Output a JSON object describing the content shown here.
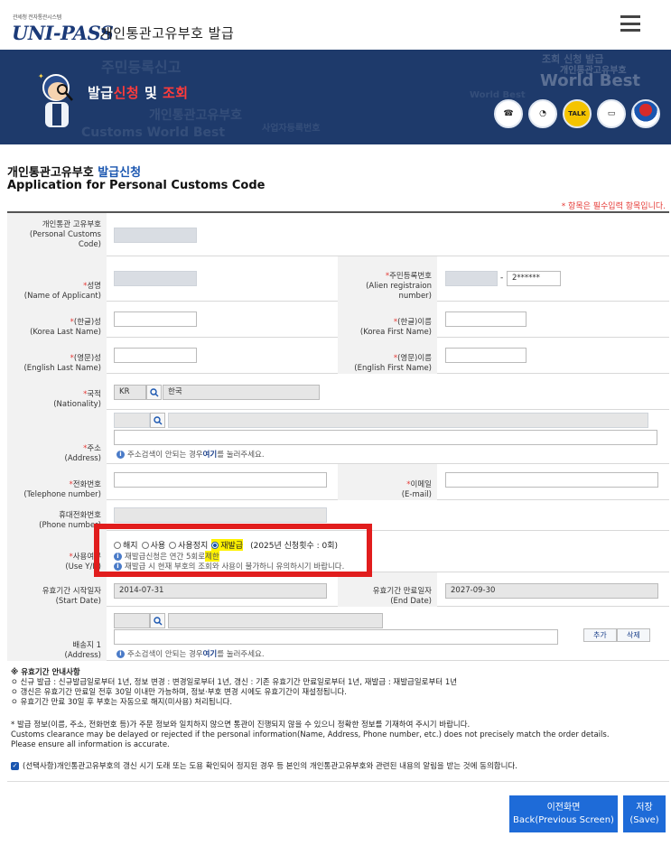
{
  "header": {
    "logo_small": "관세청 전자통관시스템",
    "logo": "UNI-PASS",
    "title": "개인통관고유부호  발급"
  },
  "banner": {
    "title_prefix": "발급",
    "title_red1": "신청",
    "title_mid": " 및 ",
    "title_red2": "조회",
    "bg_texts": [
      "주민등록신고",
      "개인통관고유부호",
      "사업자등록번호",
      "World Best",
      "Customs World Best",
      "조회 신청 발급",
      "World Best",
      "개인통관고유부호"
    ],
    "quick_icons": [
      "phone-icon",
      "clock-icon",
      "talk-icon",
      "monitor-icon",
      "taegeuk-icon"
    ],
    "talk_label": "TALK"
  },
  "page": {
    "title_ko_black": "개인통관고유부호 ",
    "title_ko_blue": "발급신청",
    "title_en": "Application for Personal Customs Code",
    "required_note": "* 항목은 필수입력 항목입니다."
  },
  "form": {
    "pcc_label": "개인통관 고유부호\n(Personal Customs Code)",
    "name_label_ko": "성명",
    "name_label_en": "(Name of Applicant)",
    "alien_label_ko": "주민등록번호",
    "alien_label_en": "(Alien registraion number)",
    "alien_suffix": "2******",
    "alien_dash": "-",
    "last_ko_label_ko": "(한글)성",
    "last_ko_label_en": "(Korea Last Name)",
    "first_ko_label_ko": "(한글)이름",
    "first_ko_label_en": "(Korea First Name)",
    "last_en_label_ko": "(영문)성",
    "last_en_label_en": "(English Last Name)",
    "first_en_label_ko": "(영문)이름",
    "first_en_label_en": "(English First Name)",
    "nation_label_ko": "국적",
    "nation_label_en": "(Nationality)",
    "nation_code": "KR",
    "nation_name": "한국",
    "address_label_ko": "주소",
    "address_label_en": "(Address)",
    "address_info_pre": "주소검색이 안되는 경우 ",
    "address_info_link": "여기",
    "address_info_post": "를 눌러주세요.",
    "tel_label_ko": "전화번호",
    "tel_label_en": "(Telephone number)",
    "email_label_ko": "이메일",
    "email_label_en": "(E-mail)",
    "phone_label_ko": "휴대전화번호",
    "phone_label_en": "(Phone number)",
    "use_label_ko": "사용여부",
    "use_label_en": "(Use Y/N)",
    "use_options": [
      "해지",
      "사용",
      "사용정지",
      "재발급"
    ],
    "reissue_count": "(2025년 신청횟수 : 0회)",
    "use_info1_pre": "재발급신청은 연간 5회로 ",
    "use_info1_hl": "제한",
    "use_info2": "재발급 시 현재 부호의 조회와 사용이 불가하니 유의하시기 바랍니다.",
    "start_label_ko": "유효기간 시작일자",
    "start_label_en": "(Start Date)",
    "start_date": "2014-07-31",
    "end_label_ko": "유효기간 만료일자",
    "end_label_en": "(End Date)",
    "end_date": "2027-09-30",
    "ship_label_ko": "배송지 1",
    "ship_label_en": "(Address)",
    "add_button": "추가",
    "delete_button": "삭제"
  },
  "notes": {
    "heading": "※ 유효기간 안내사항",
    "line1": "ㅇ 신규 발급 : 신규발급일로부터 1년, 정보 변경 : 변경일로부터 1년, 갱신 : 기존 유효기간 만료일로부터 1년, 재발급 : 재발급일로부터 1년",
    "line2": "ㅇ 갱신은 유효기간 만료일 전후 30일 이내만 가능하며, 정보·부호 변경 시에도 유효기간이 재설정됩니다.",
    "line3": "ㅇ 유효기간 만료 30일 후 부호는 자동으로 해지(미사용) 처리됩니다.",
    "warn1": "* 발급 정보(이름, 주소, 전화번호 등)가 주문 정보와 일치하지 않으면 통관이 진행되지 않을 수 있으니 정확한 정보를 기재하여 주시기 바랍니다.",
    "warn2": "Customs clearance may be delayed or rejected if the personal information(Name, Address, Phone number, etc.) does not precisely match the order details.",
    "warn3": "Please ensure all information is accurate.",
    "agree": "(선택사항)개인통관고유부호의 갱신 시기 도래 또는 도용 확인되어 정지된 경우 등 본인의 개인통관고유부호와 관련된 내용의 알림을 받는 것에 동의합니다."
  },
  "buttons": {
    "prev_ko": "이전화면",
    "prev_en": "Back(Previous Screen)",
    "save_ko": "저장",
    "save_en": "(Save)"
  },
  "colors": {
    "accent": "#1e6bd8",
    "banner": "#1e3a6b",
    "required": "#e53935",
    "highlight": "#fff200",
    "annotation": "#e11d1d"
  }
}
